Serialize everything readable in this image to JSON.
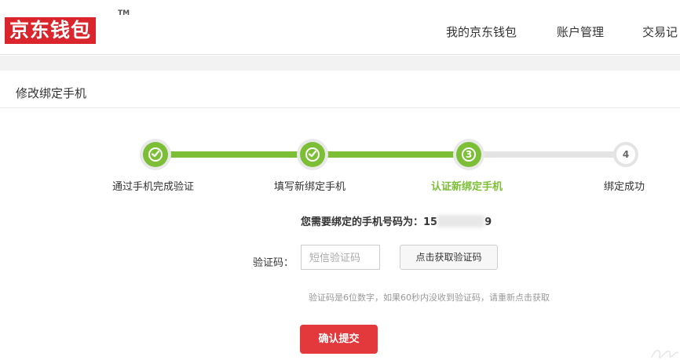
{
  "header": {
    "logo": "京东钱包",
    "trademark": "TM",
    "nav": [
      "我的京东钱包",
      "账户管理",
      "交易记"
    ]
  },
  "page": {
    "title": "修改绑定手机"
  },
  "steps": [
    {
      "label": "通过手机完成验证",
      "state": "done"
    },
    {
      "label": "填写新绑定手机",
      "state": "done"
    },
    {
      "label": "认证新绑定手机",
      "number": "3",
      "state": "current"
    },
    {
      "label": "绑定成功",
      "number": "4",
      "state": "todo"
    }
  ],
  "form": {
    "phone_prefix": "您需要绑定的手机号码为：15",
    "phone_suffix": "9",
    "code_label": "验证码：",
    "code_placeholder": "短信验证码",
    "get_code_label": "点击获取验证码",
    "hint": "验证码是6位数字，如果60秒内没收到验证码，请重新点击获取",
    "submit_label": "确认提交"
  },
  "colors": {
    "brand_red": "#d9252b",
    "progress_green": "#7cbf37",
    "submit_red": "#e4393c"
  }
}
